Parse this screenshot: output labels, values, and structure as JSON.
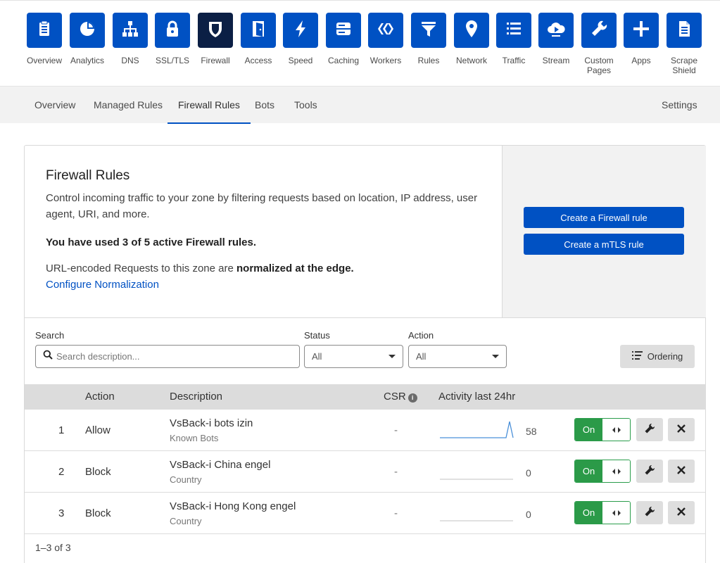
{
  "apps": [
    {
      "label": "Overview",
      "icon": "overview-icon"
    },
    {
      "label": "Analytics",
      "icon": "analytics-icon"
    },
    {
      "label": "DNS",
      "icon": "dns-icon"
    },
    {
      "label": "SSL/TLS",
      "icon": "lock-icon"
    },
    {
      "label": "Firewall",
      "icon": "shield-icon",
      "active": true
    },
    {
      "label": "Access",
      "icon": "door-icon"
    },
    {
      "label": "Speed",
      "icon": "lightning-icon"
    },
    {
      "label": "Caching",
      "icon": "server-icon"
    },
    {
      "label": "Workers",
      "icon": "workers-icon"
    },
    {
      "label": "Rules",
      "icon": "filter-icon"
    },
    {
      "label": "Network",
      "icon": "location-pin-icon"
    },
    {
      "label": "Traffic",
      "icon": "list-icon"
    },
    {
      "label": "Stream",
      "icon": "cloud-play-icon"
    },
    {
      "label": "Custom Pages",
      "icon": "wrench-icon"
    },
    {
      "label": "Apps",
      "icon": "plus-icon"
    },
    {
      "label": "Scrape Shield",
      "icon": "document-icon"
    }
  ],
  "subnav": {
    "tabs": [
      "Overview",
      "Managed Rules",
      "Firewall Rules",
      "Bots",
      "Tools"
    ],
    "active_tab": "Firewall Rules",
    "settings": "Settings"
  },
  "intro": {
    "title": "Firewall Rules",
    "description": "Control incoming traffic to your zone by filtering requests based on location, IP address, user agent, URI, and more.",
    "usage": "You have used 3 of 5 active Firewall rules.",
    "normalization_prefix": "URL-encoded Requests to this zone are ",
    "normalization_bold": "normalized at the edge.",
    "configure_link": "Configure Normalization",
    "create_firewall_button": "Create a Firewall rule",
    "create_mtls_button": "Create a mTLS rule"
  },
  "filters": {
    "search_label": "Search",
    "search_placeholder": "Search description...",
    "status_label": "Status",
    "status_value": "All",
    "action_label": "Action",
    "action_value": "All",
    "ordering_button": "Ordering"
  },
  "table": {
    "headers": {
      "action": "Action",
      "description": "Description",
      "csr": "CSR",
      "activity": "Activity last 24hr"
    },
    "rows": [
      {
        "priority": "1",
        "action": "Allow",
        "description": "VsBack-i bots izin",
        "sub": "Known Bots",
        "csr": "-",
        "activity_count": "58",
        "enabled_label": "On"
      },
      {
        "priority": "2",
        "action": "Block",
        "description": "VsBack-i China engel",
        "sub": "Country",
        "csr": "-",
        "activity_count": "0",
        "enabled_label": "On"
      },
      {
        "priority": "3",
        "action": "Block",
        "description": "VsBack-i Hong Kong engel",
        "sub": "Country",
        "csr": "-",
        "activity_count": "0",
        "enabled_label": "On"
      }
    ],
    "pagination": "1–3 of 3"
  },
  "colors": {
    "brand_blue": "#0051c3",
    "active_tile": "#0b1f45",
    "toggle_green": "#2b9a48"
  }
}
